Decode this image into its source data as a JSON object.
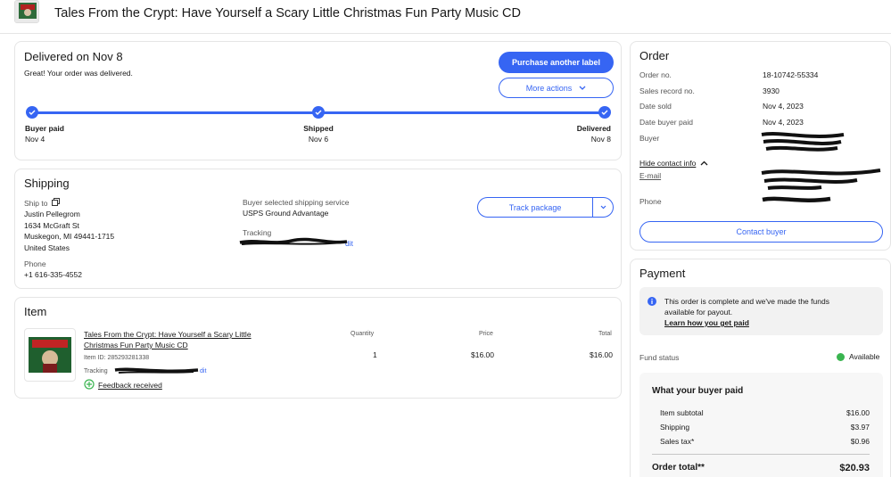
{
  "header": {
    "title": "Tales From the Crypt: Have Yourself a Scary Little Christmas Fun Party Music CD"
  },
  "status": {
    "heading": "Delivered on Nov 8",
    "subtext": "Great! Your order was delivered.",
    "purchase_label_button": "Purchase another label",
    "more_actions_button": "More actions",
    "steps": [
      {
        "label": "Buyer paid",
        "date": "Nov 4"
      },
      {
        "label": "Shipped",
        "date": "Nov 6"
      },
      {
        "label": "Delivered",
        "date": "Nov 8"
      }
    ]
  },
  "shipping": {
    "heading": "Shipping",
    "ship_to_label": "Ship to",
    "name": "Justin Pellegrom",
    "street": "1634 McGraft St",
    "city": "Muskegon, MI 49441-1715",
    "country": "United States",
    "phone_label": "Phone",
    "phone": "+1 616-335-4552",
    "service_label": "Buyer selected shipping service",
    "service": "USPS Ground Advantage",
    "tracking_label": "Tracking",
    "tracking_edit": "dit",
    "track_button": "Track package"
  },
  "item": {
    "heading": "Item",
    "title": "Tales From the Crypt: Have Yourself a Scary Little Christmas Fun Party Music CD",
    "item_id": "Item ID: 285293281338",
    "tracking_label": "Tracking",
    "tracking_edit": "dit",
    "feedback": "Feedback received",
    "quantity_label": "Quantity",
    "quantity": "1",
    "price_label": "Price",
    "price": "$16.00",
    "total_label": "Total",
    "total": "$16.00"
  },
  "order": {
    "heading": "Order",
    "rows": [
      {
        "label": "Order no.",
        "value": "18-10742-55334"
      },
      {
        "label": "Sales record no.",
        "value": "3930"
      },
      {
        "label": "Date sold",
        "value": "Nov 4, 2023"
      },
      {
        "label": "Date buyer paid",
        "value": "Nov 4, 2023"
      },
      {
        "label": "Buyer",
        "value": ""
      }
    ],
    "hide_contact": "Hide contact info",
    "email_label": "E-mail",
    "phone_label": "Phone",
    "contact_button": "Contact buyer"
  },
  "payment": {
    "heading": "Payment",
    "notice_line1": "This order is complete and we've made the funds",
    "notice_line2": "available for payout.",
    "notice_link": "Learn how you get paid",
    "fund_status_label": "Fund status",
    "fund_status": "Available",
    "buyer_paid_heading": "What your buyer paid",
    "item_subtotal_label": "Item subtotal",
    "item_subtotal": "$16.00",
    "shipping_label": "Shipping",
    "shipping": "$3.97",
    "tax_label": "Sales tax*",
    "tax": "$0.96",
    "order_total_label": "Order total**",
    "order_total": "$20.93"
  },
  "colors": {
    "accent": "#3665f3",
    "available": "#3ab550",
    "border": "#e5e5e5"
  }
}
